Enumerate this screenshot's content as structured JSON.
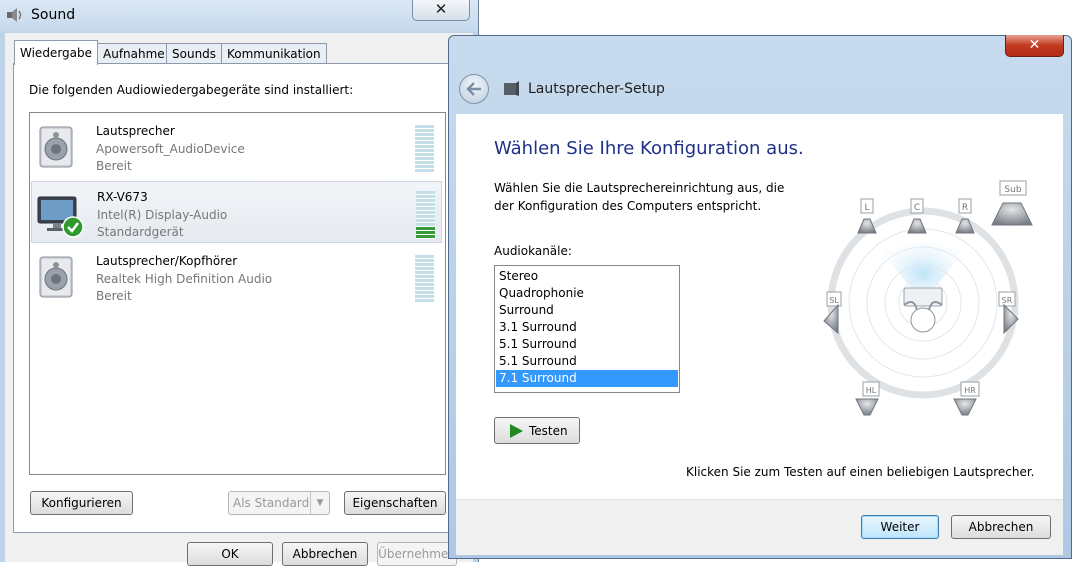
{
  "sound_window": {
    "title": "Sound",
    "close_glyph": "✕",
    "tabs": [
      {
        "label": "Wiedergabe",
        "active": true
      },
      {
        "label": "Aufnahme",
        "active": false
      },
      {
        "label": "Sounds",
        "active": false
      },
      {
        "label": "Kommunikation",
        "active": false
      }
    ],
    "installed_label": "Die folgenden Audiowiedergabegeräte sind installiert:",
    "devices": [
      {
        "name": "Lautsprecher",
        "driver": "Apowersoft_AudioDevice",
        "status": "Bereit",
        "icon": "speaker-icon",
        "selected": false,
        "default": false,
        "level": 0
      },
      {
        "name": "RX-V673",
        "driver": "Intel(R) Display-Audio",
        "status": "Standardgerät",
        "icon": "monitor-icon",
        "selected": true,
        "default": true,
        "level": 0.25
      },
      {
        "name": "Lautsprecher/Kopfhörer",
        "driver": "Realtek High Definition Audio",
        "status": "Bereit",
        "icon": "speaker-icon",
        "selected": false,
        "default": false,
        "level": 0
      }
    ],
    "buttons": {
      "configure": "Konfigurieren",
      "set_default": "Als Standard",
      "properties": "Eigenschaften",
      "ok": "OK",
      "cancel": "Abbrechen",
      "apply": "Übernehmen"
    }
  },
  "setup_dialog": {
    "title": "Lautsprecher-Setup",
    "close_glyph": "✕",
    "heading": "Wählen Sie Ihre Konfiguration aus.",
    "description_line1": "Wählen Sie die Lautsprechereinrichtung aus, die",
    "description_line2": "der Konfiguration des Computers entspricht.",
    "channels_label": "Audiokanäle:",
    "channels": [
      "Stereo",
      "Quadrophonie",
      "Surround",
      "3.1 Surround",
      "5.1 Surround",
      "5.1 Surround",
      "7.1 Surround"
    ],
    "selected_channel": "7.1 Surround",
    "test_button": "Testen",
    "hint": "Klicken Sie zum Testen auf einen beliebigen Lautsprecher.",
    "speaker_labels": [
      "L",
      "C",
      "R",
      "Sub",
      "SL",
      "SR",
      "HL",
      "HR"
    ],
    "next_button": "Weiter",
    "cancel_button": "Abbrechen"
  },
  "colors": {
    "selection": "#3399ff",
    "heading": "#1e3287",
    "close_red": "#c2391f"
  }
}
